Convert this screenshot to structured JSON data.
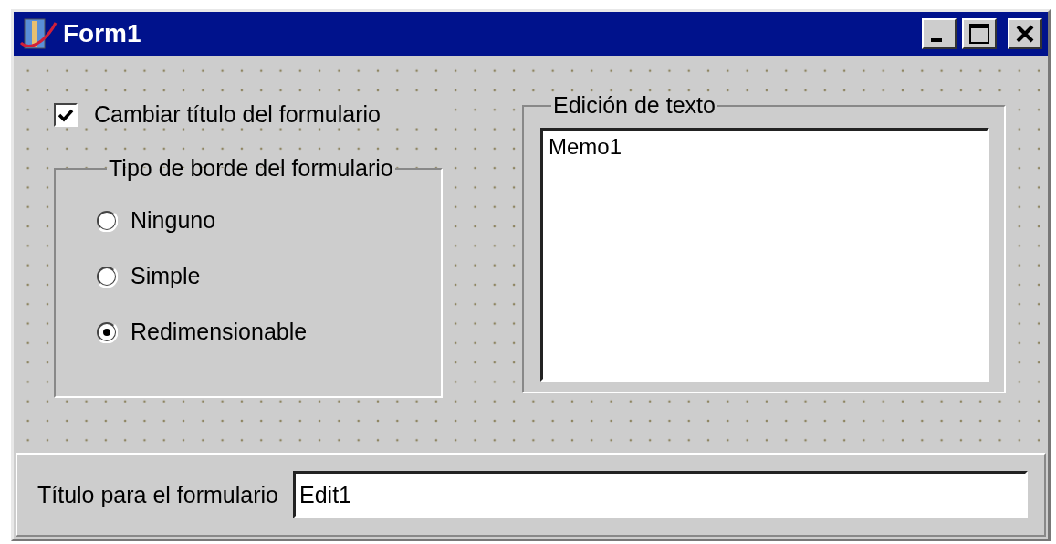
{
  "window": {
    "title": "Form1"
  },
  "checkbox": {
    "label": "Cambiar título del formulario",
    "checked": true
  },
  "border_group": {
    "title": "Tipo de borde del formulario",
    "options": [
      {
        "label": "Ninguno",
        "selected": false
      },
      {
        "label": "Simple",
        "selected": false
      },
      {
        "label": "Redimensionable",
        "selected": true
      }
    ]
  },
  "memo_group": {
    "title": "Edición de texto",
    "value": "Memo1"
  },
  "bottom_panel": {
    "label": "Título para el formulario",
    "value": "Edit1"
  }
}
